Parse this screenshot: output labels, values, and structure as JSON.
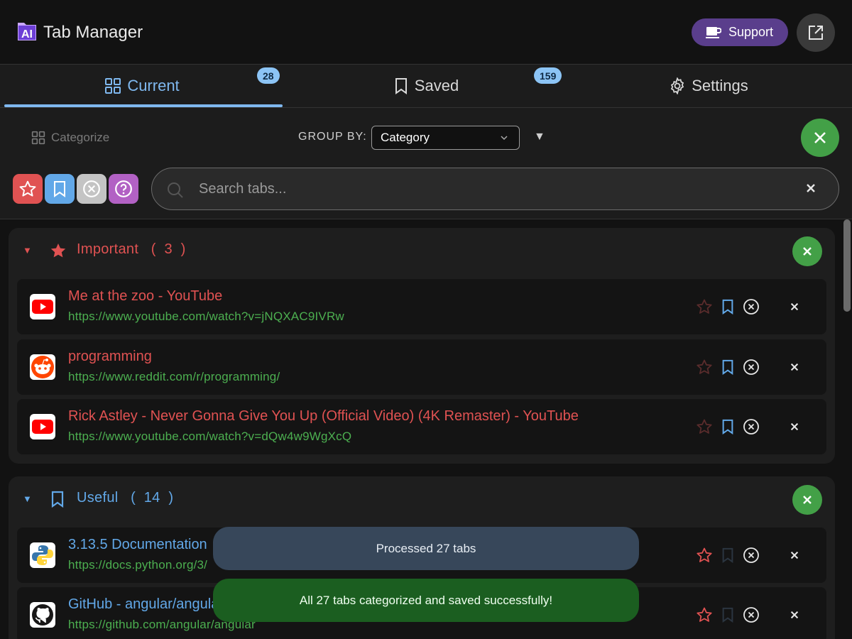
{
  "header": {
    "logo_text": "AI",
    "title": "Tab Manager",
    "support_label": "Support",
    "open_icon": "open-external-icon"
  },
  "tabs": [
    {
      "label": "Current",
      "badge": "28",
      "active": true,
      "icon": "grid-icon"
    },
    {
      "label": "Saved",
      "badge": "159",
      "active": false,
      "icon": "bookmark-icon"
    },
    {
      "label": "Settings",
      "active": false,
      "icon": "gear-icon"
    }
  ],
  "toolbar": {
    "categorize_label": "Categorize",
    "group_by_label": "GROUP BY:",
    "group_by_value": "Category",
    "sort_arrow": "▼",
    "filters": [
      {
        "name": "important-filter",
        "icon": "star-icon",
        "color": "#e05252"
      },
      {
        "name": "useful-filter",
        "icon": "bookmark-icon",
        "color": "#62a8e8"
      },
      {
        "name": "ignore-filter",
        "icon": "circle-x-icon",
        "color": "#c4c4c4"
      },
      {
        "name": "uncategorized-filter",
        "icon": "question-icon",
        "color": "#b261c4"
      }
    ],
    "search_placeholder": "Search tabs..."
  },
  "groups": [
    {
      "title": "Important",
      "count": "3",
      "color": "#e05252",
      "tabs": [
        {
          "title": "Me at the zoo - YouTube",
          "url": "https://www.youtube.com/watch?v=jNQXAC9IVRw",
          "site": "youtube"
        },
        {
          "title": "programming",
          "url": "https://www.reddit.com/r/programming/",
          "site": "reddit"
        },
        {
          "title": "Rick Astley - Never Gonna Give You Up (Official Video) (4K Remaster) - YouTube",
          "url": "https://www.youtube.com/watch?v=dQw4w9WgXcQ",
          "site": "youtube"
        }
      ]
    },
    {
      "title": "Useful",
      "count": "14",
      "color": "#62a8e8",
      "tabs": [
        {
          "title": "3.13.5 Documentation",
          "url": "https://docs.python.org/3/",
          "site": "python"
        },
        {
          "title": "GitHub - angular/angular",
          "url": "https://github.com/angular/angular",
          "site": "github"
        }
      ]
    }
  ],
  "toasts": {
    "info": "Processed 27 tabs",
    "success": "All 27 tabs categorized and saved successfully!"
  }
}
